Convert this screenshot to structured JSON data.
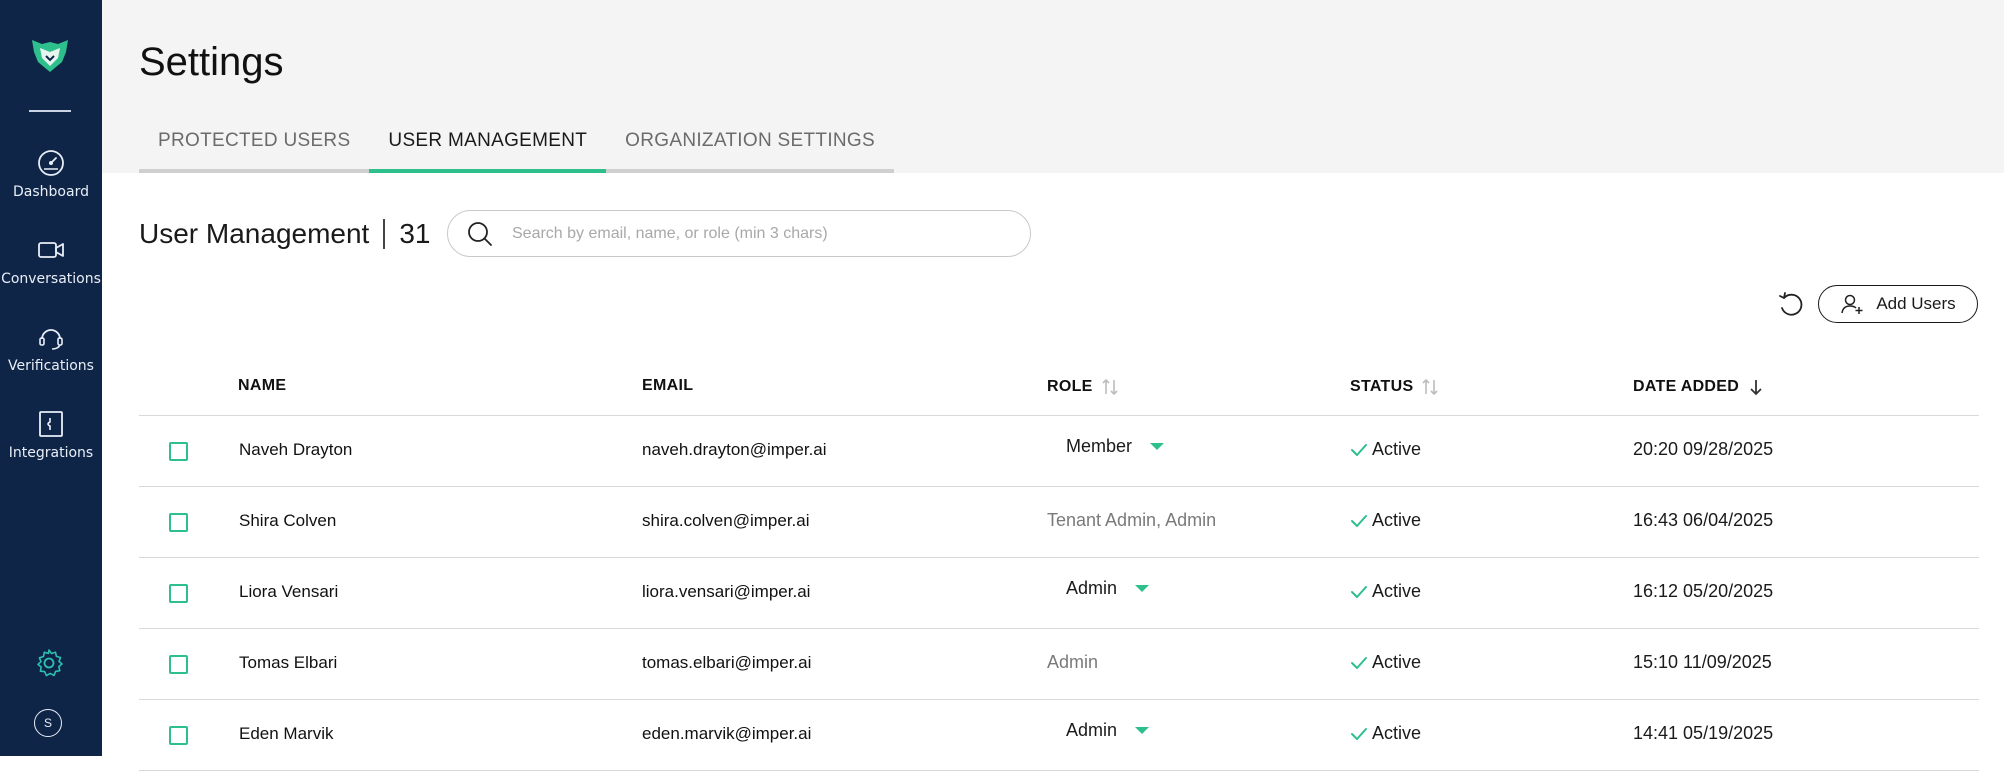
{
  "sidebar": {
    "items": [
      {
        "label": "Dashboard",
        "icon": "gauge-icon"
      },
      {
        "label": "Conversations",
        "icon": "video-camera-icon"
      },
      {
        "label": "Verifications",
        "icon": "headset-icon"
      },
      {
        "label": "Integrations",
        "icon": "puzzle-icon"
      }
    ],
    "avatar_initial": "S"
  },
  "header": {
    "title": "Settings",
    "tabs": [
      {
        "label": "PROTECTED USERS",
        "active": false
      },
      {
        "label": "USER MANAGEMENT",
        "active": true
      },
      {
        "label": "ORGANIZATION SETTINGS",
        "active": false
      }
    ]
  },
  "section": {
    "title": "User Management",
    "count": "31"
  },
  "search": {
    "placeholder": "Search by email, name, or role (min 3 chars)",
    "value": ""
  },
  "actions": {
    "add_users_label": "Add Users"
  },
  "table": {
    "columns": {
      "name": "NAME",
      "email": "EMAIL",
      "role": "ROLE",
      "status": "STATUS",
      "date_added": "DATE ADDED"
    },
    "rows": [
      {
        "name": "Naveh Drayton",
        "email": "naveh.drayton@imper.ai",
        "role": "Member",
        "role_editable": true,
        "status": "Active",
        "date_added": "20:20 09/28/2025"
      },
      {
        "name": "Shira Colven",
        "email": "shira.colven@imper.ai",
        "role": "Tenant Admin, Admin",
        "role_editable": false,
        "status": "Active",
        "date_added": "16:43 06/04/2025"
      },
      {
        "name": "Liora Vensari",
        "email": "liora.vensari@imper.ai",
        "role": "Admin",
        "role_editable": true,
        "status": "Active",
        "date_added": "16:12 05/20/2025"
      },
      {
        "name": "Tomas Elbari",
        "email": "tomas.elbari@imper.ai",
        "role": "Admin",
        "role_editable": false,
        "status": "Active",
        "date_added": "15:10 11/09/2025"
      },
      {
        "name": "Eden Marvik",
        "email": "eden.marvik@imper.ai",
        "role": "Admin",
        "role_editable": true,
        "status": "Active",
        "date_added": "14:41 05/19/2025"
      }
    ]
  },
  "colors": {
    "sidebar_bg": "#0f2547",
    "accent": "#2dbf8c",
    "header_bg": "#f4f4f4"
  }
}
